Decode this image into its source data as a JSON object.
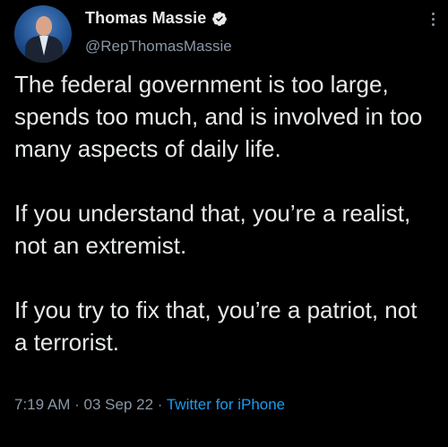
{
  "tweet": {
    "display_name": "Thomas Massie",
    "handle": "@RepThomasMassie",
    "verified_icon": "verified-badge-icon",
    "paragraphs": [
      "The federal government is too large, spends too much, and is involved in too many aspects of daily life.",
      "If you understand that, you’re a realist, not an extremist.",
      "If you try to fix that, you’re a patriot, not a terrorist."
    ],
    "time": "7:19 AM",
    "separator": "·",
    "date": "03 Sep 22",
    "source": "Twitter for iPhone"
  },
  "colors": {
    "background": "#000000",
    "text": "#e7e9ea",
    "muted": "#8b98a5",
    "accent": "#1d9bf0"
  }
}
